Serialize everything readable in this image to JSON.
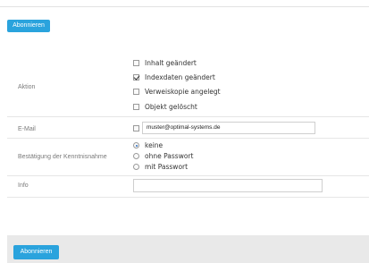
{
  "top_button": {
    "label": "Abonnieren"
  },
  "form": {
    "action": {
      "label": "Aktion",
      "options": [
        {
          "label": "Inhalt geändert",
          "checked": false
        },
        {
          "label": "Indexdaten geändert",
          "checked": true
        },
        {
          "label": "Verweiskopie angelegt",
          "checked": false
        },
        {
          "label": "Objekt gelöscht",
          "checked": false
        }
      ]
    },
    "email": {
      "label": "E-Mail",
      "checked": false,
      "value": "muster@optimal-systems.de"
    },
    "confirmation": {
      "label": "Bestätigung der Kenntnisnahme",
      "options": [
        {
          "label": "keine",
          "selected": true
        },
        {
          "label": "ohne Passwort",
          "selected": false
        },
        {
          "label": "mit Passwort",
          "selected": false
        }
      ]
    },
    "info": {
      "label": "Info",
      "value": ""
    }
  },
  "footer": {
    "button_label": "Abonnieren"
  },
  "colors": {
    "accent": "#2aa3dd",
    "footer_bg": "#e9e9e9"
  }
}
